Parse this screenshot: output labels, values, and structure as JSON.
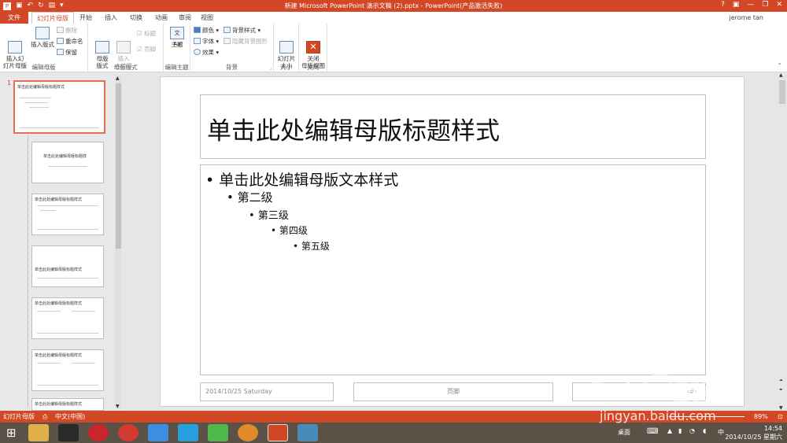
{
  "window": {
    "title": "新建 Microsoft PowerPoint 演示文稿 (2).pptx - PowerPoint(产品激活失败)",
    "controls": [
      "?",
      "▣",
      "—",
      "❐",
      "✕"
    ]
  },
  "quick_access": [
    "save-icon",
    "undo-icon",
    "redo-icon",
    "start-from-beginning-icon",
    "customize-icon"
  ],
  "tabs": [
    "文件",
    "幻灯片母版",
    "开始",
    "插入",
    "切换",
    "动画",
    "审阅",
    "视图"
  ],
  "user": "jerome tan",
  "ribbon": {
    "groups": [
      {
        "label": "编辑母版",
        "buttons": [
          {
            "label": "插入幻\n灯片母版",
            "icon": "insert-slide-master-icon"
          },
          {
            "label": "插入版式",
            "icon": "insert-layout-icon"
          }
        ],
        "small": [
          {
            "label": "删除",
            "icon": "delete-icon",
            "disabled": true
          },
          {
            "label": "重命名",
            "icon": "rename-icon",
            "disabled": false
          },
          {
            "label": "保留",
            "icon": "preserve-icon",
            "disabled": false
          }
        ]
      },
      {
        "label": "母版版式",
        "buttons": [
          {
            "label": "母版\n版式",
            "icon": "master-layout-icon"
          },
          {
            "label": "插入\n占位符",
            "icon": "insert-placeholder-icon",
            "disabled": true
          }
        ],
        "checks": [
          {
            "label": "标题",
            "checked": true
          },
          {
            "label": "页脚",
            "checked": true
          }
        ]
      },
      {
        "label": "编辑主题",
        "buttons": [
          {
            "label": "主题",
            "icon": "themes-icon"
          }
        ]
      },
      {
        "label": "背景",
        "small": [
          {
            "label": "颜色",
            "icon": "colors-icon"
          },
          {
            "label": "字体",
            "icon": "fonts-icon"
          },
          {
            "label": "效果",
            "icon": "effects-icon"
          },
          {
            "label": "背景样式",
            "icon": "background-styles-icon"
          },
          {
            "label": "隐藏背景图形",
            "icon": "checkbox-icon",
            "disabled": true
          }
        ]
      },
      {
        "label": "大小",
        "buttons": [
          {
            "label": "幻灯片\n大小",
            "icon": "slide-size-icon"
          }
        ]
      },
      {
        "label": "关闭",
        "buttons": [
          {
            "label": "关闭\n母版视图",
            "icon": "close-master-view-icon"
          }
        ]
      }
    ]
  },
  "thumbnails": {
    "selected_number": "1",
    "master_title": "单击此处编辑母版标题样式",
    "layout_titles": [
      "单击此处编辑母版标题样",
      "单击此处编辑母版标题样式",
      "单击此处编辑母版标题样式",
      "单击此处编辑母版标题样式",
      "单击此处编辑母版标题样式",
      "单击此处编辑母版标题样式"
    ]
  },
  "slide": {
    "title": "单击此处编辑母版标题样式",
    "levels": [
      "单击此处编辑母版文本样式",
      "第二级",
      "第三级",
      "第四级",
      "第五级"
    ],
    "date": "2014/10/25 Saturday",
    "footer": "页脚",
    "number": "‹#›"
  },
  "statusbar": {
    "view": "幻灯片母版",
    "language": "中文(中国)",
    "zoom": "89%"
  },
  "taskbar": {
    "apps": [
      "file-explorer-icon",
      "qq-icon",
      "netease-music-icon",
      "sogou-icon",
      "baidu-cloud-icon",
      "network-icon",
      "iqiyi-icon",
      "media-player-icon",
      "powerpoint-icon",
      "photos-icon"
    ],
    "desktop_label": "桌面",
    "ime": "中",
    "time": "14:54",
    "date": "2014/10/25 星期六"
  },
  "watermark": {
    "text": "Baidu经验",
    "url": "jingyan.baidu.com"
  },
  "colors": {
    "accent": "#d24726",
    "taskbar": "#5a5246"
  }
}
